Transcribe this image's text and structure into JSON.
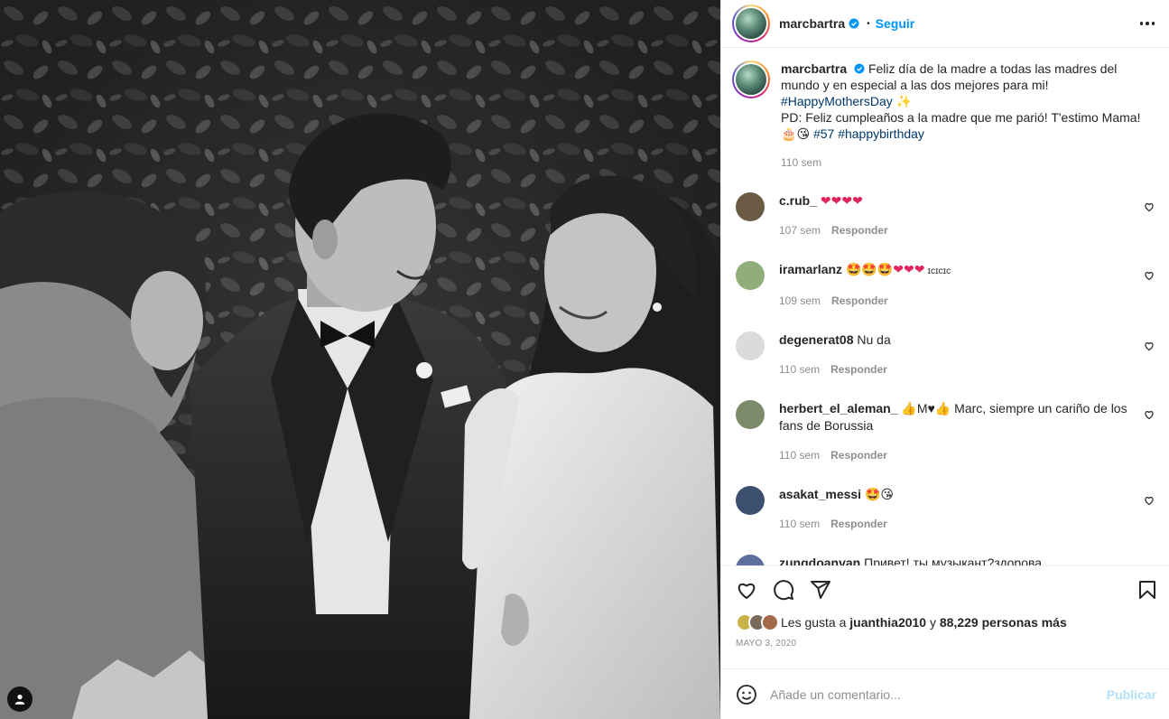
{
  "post": {
    "author": "marcbartra",
    "follow_label": "Seguir",
    "caption": {
      "line1": "Feliz día de la madre a todas las madres del mundo y en especial a las dos mejores para mi!",
      "hashtag1": "#HappyMothersDay",
      "line2": "PD: Feliz cumpleaños a la madre que me parió! T'estimo Mama!",
      "hashtag2": "#57",
      "hashtag3": "#happybirthday",
      "time": "110 sem"
    },
    "reply_label": "Responder",
    "comments": [
      {
        "user": "c.rub_",
        "text": "",
        "time": "107 sem",
        "avatar_color": "#6b5a44"
      },
      {
        "user": "iramarlanz",
        "text": "ɪᴄɪᴄɪᴄ",
        "time": "109 sem",
        "avatar_color": "#8fae7a"
      },
      {
        "user": "degenerat08",
        "text": "Nu da",
        "time": "110 sem",
        "avatar_color": "#dbdbdb"
      },
      {
        "user": "herbert_el_aleman_",
        "text": "Marc, siempre un cariño de los fans de Borussia",
        "time": "110 sem",
        "avatar_color": "#7c8a6a",
        "mid": "M♥"
      },
      {
        "user": "asakat_messi",
        "text": "",
        "time": "110 sem",
        "avatar_color": "#3c4f6e"
      },
      {
        "user": "zungdoanvan",
        "text": "Привет! ты музыкант?здорова.",
        "time": "",
        "avatar_color": "#5d6f9e"
      }
    ],
    "likes": {
      "prefix": "Les gusta a",
      "user": "juanthia2010",
      "middle": "y",
      "count": "88,229 personas más"
    },
    "date": "MAYO 3, 2020",
    "add_comment_placeholder": "Añade un comentario...",
    "publish_label": "Publicar"
  },
  "icons": {
    "header_more": "more-options-icon",
    "like": "heart-icon",
    "comment": "comment-icon",
    "share": "share-icon",
    "save": "bookmark-icon",
    "emoji": "emoji-icon",
    "tags": "user-tag-icon"
  },
  "colors": {
    "accent": "#0095f6",
    "hashtag": "#00376b",
    "muted": "#8e8e8e",
    "heart": "#e0245e"
  }
}
